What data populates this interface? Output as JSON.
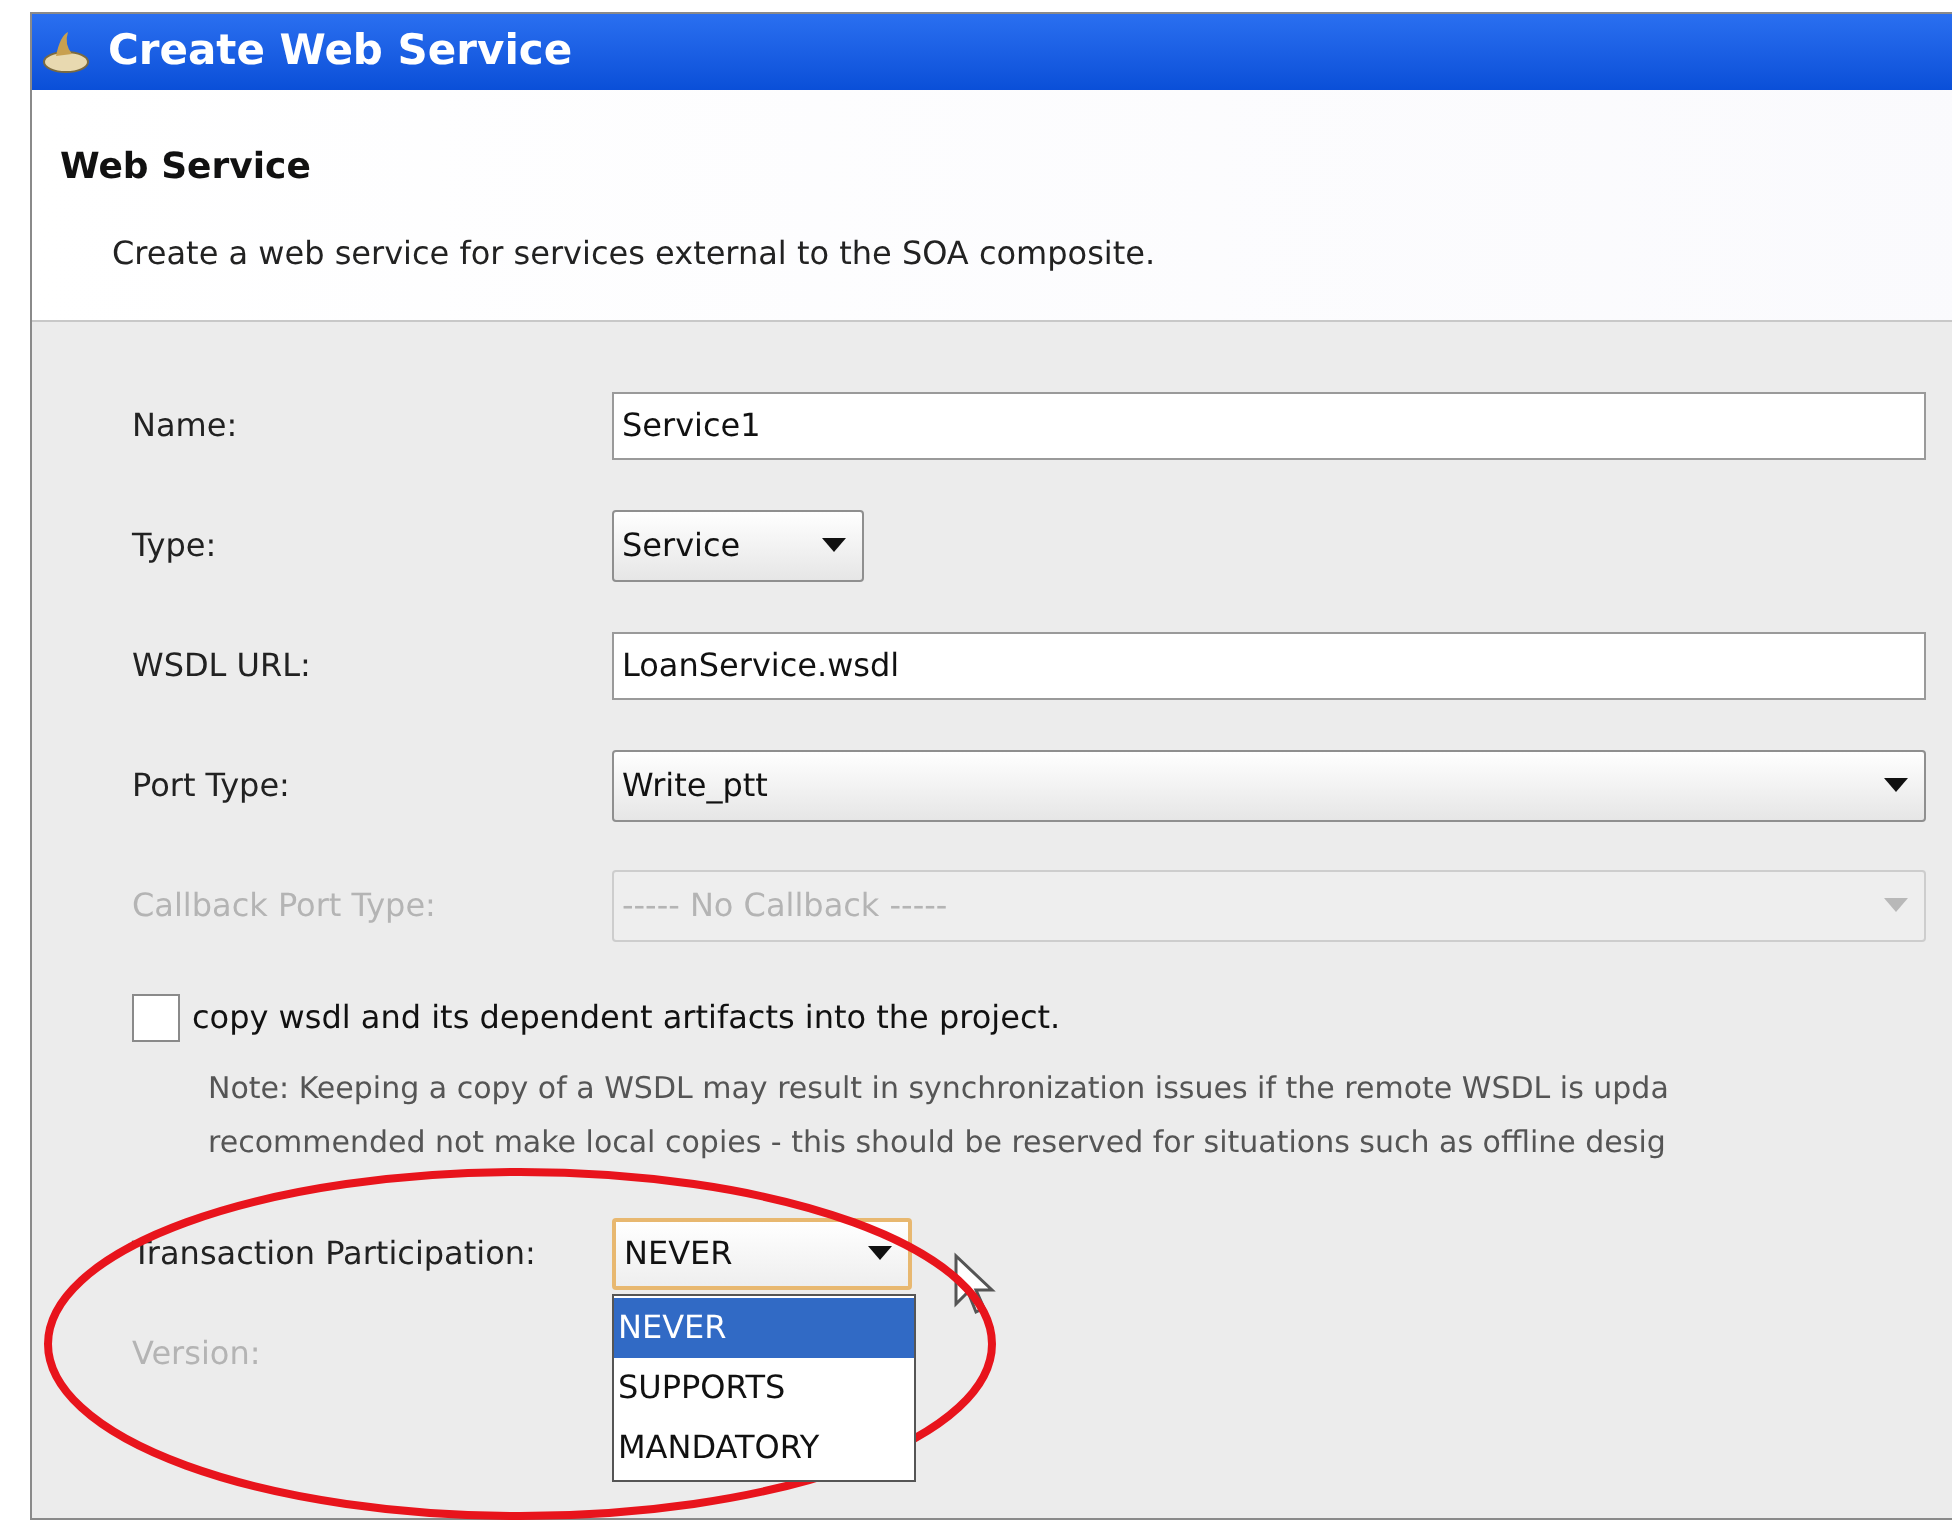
{
  "window": {
    "title": "Create Web Service"
  },
  "header": {
    "title": "Web Service",
    "description": "Create a web service for services external to the SOA composite."
  },
  "fields": [
    {
      "kind": "text",
      "label": "Name:",
      "value": "Service1",
      "disabled": false
    },
    {
      "kind": "select-small",
      "label": "Type:",
      "value": "Service",
      "disabled": false
    },
    {
      "kind": "text",
      "label": "WSDL URL:",
      "value": "LoanService.wsdl",
      "disabled": false
    },
    {
      "kind": "select",
      "label": "Port Type:",
      "value": "Write_ptt",
      "disabled": false
    },
    {
      "kind": "select",
      "label": "Callback Port Type:",
      "value": "----- No Callback -----",
      "disabled": true
    }
  ],
  "copy_option": {
    "label": "copy wsdl and its dependent artifacts into the project.",
    "checked": false
  },
  "note": [
    "Note: Keeping a copy of a WSDL may result in synchronization issues if the remote WSDL is upda",
    "recommended not make local copies - this should be reserved for situations such as offline desig"
  ],
  "transaction": {
    "label": "Transaction Participation:",
    "value": "NEVER",
    "expanded": true,
    "options": [
      {
        "label": "NEVER",
        "selected": true
      },
      {
        "label": "SUPPORTS",
        "selected": false
      },
      {
        "label": "MANDATORY",
        "selected": false
      }
    ]
  },
  "version": {
    "label": "Version:",
    "disabled": true
  }
}
